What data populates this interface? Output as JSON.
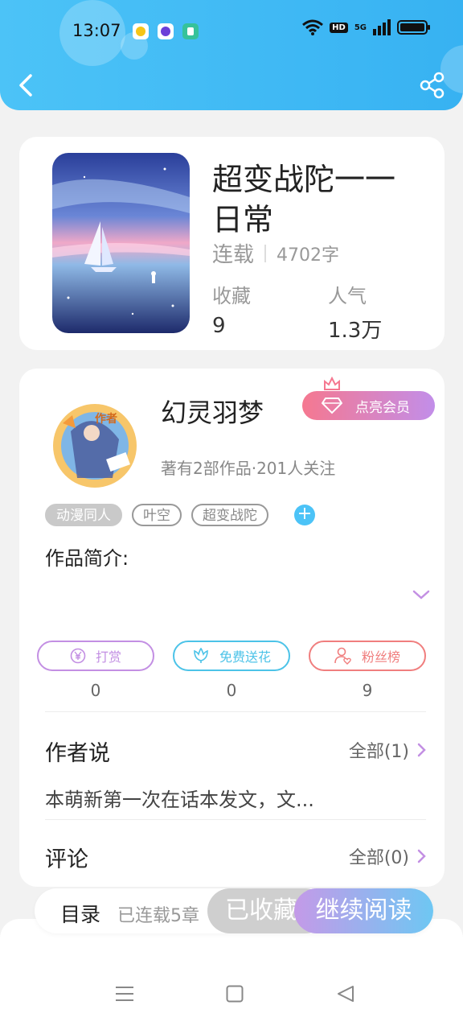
{
  "status_bar": {
    "time": "13:07",
    "hd": "HD",
    "network": "5G",
    "notification_icons": [
      "qq-app-icon",
      "purple-app-icon",
      "green-shield-app-icon"
    ]
  },
  "header": {
    "back_icon": "chevron-left-icon",
    "share_icon": "share-icon"
  },
  "book": {
    "title": "超变战陀一一日常",
    "status": "连载",
    "word_count": "4702字",
    "favorites_label": "收藏",
    "favorites_value": "9",
    "popularity_label": "人气",
    "popularity_value": "1.3万"
  },
  "author": {
    "avatar_badge": "作者",
    "name": "幻灵羽梦",
    "vip_label": "点亮会员",
    "stats": "著有2部作品·201人关注"
  },
  "tags": [
    "动漫同人",
    "叶空",
    "超变战陀"
  ],
  "intro": {
    "label": "作品简介:"
  },
  "actions": [
    {
      "label": "打赏",
      "count": "0",
      "icon": "yen-coin-icon",
      "color": "#c38fe3"
    },
    {
      "label": "免费送花",
      "count": "0",
      "icon": "flower-icon",
      "color": "#4cc3e8"
    },
    {
      "label": "粉丝榜",
      "count": "9",
      "icon": "user-heart-icon",
      "color": "#f07e7e"
    }
  ],
  "author_says": {
    "title": "作者说",
    "link": "全部(1)",
    "preview": "本萌新第一次在话本发文，文..."
  },
  "comments": {
    "title": "评论",
    "link": "全部(0)"
  },
  "bottom_bar": {
    "catalog": "目录",
    "chapters": "已连载5章",
    "collected": "已收藏",
    "continue": "继续阅读"
  },
  "nav": [
    "menu-icon",
    "home-square-icon",
    "back-triangle-icon"
  ],
  "colors": {
    "accent_blue": "#4cc3f7",
    "accent_purple": "#c38fe3"
  }
}
